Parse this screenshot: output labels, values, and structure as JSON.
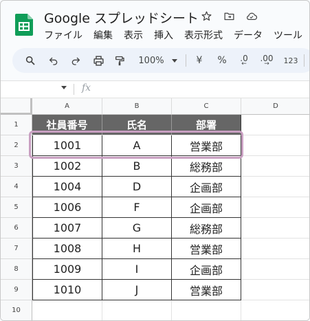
{
  "app": {
    "title": "Google スプレッドシート",
    "brand_color": "#0f9d58"
  },
  "title_icons": [
    {
      "name": "star-icon",
      "glyph": "☆"
    },
    {
      "name": "move-to-folder-icon",
      "glyph": "folder"
    },
    {
      "name": "cloud-status-icon",
      "glyph": "cloud"
    }
  ],
  "menu": [
    "ファイル",
    "編集",
    "表示",
    "挿入",
    "表示形式",
    "データ",
    "ツール"
  ],
  "toolbar": {
    "zoom": "100%",
    "currency_symbol": "¥",
    "percent_symbol": "%",
    "decrease_decimal": ".0",
    "increase_decimal": ".00",
    "number_format": "123"
  },
  "formula_bar": {
    "fx_label": "fx",
    "cell_ref": "",
    "content": ""
  },
  "columns": [
    "A",
    "B",
    "C",
    "D"
  ],
  "rows": [
    "1",
    "2",
    "3",
    "4",
    "5",
    "6",
    "7",
    "8",
    "9",
    "10"
  ],
  "table": {
    "headers": [
      "社員番号",
      "氏名",
      "部署"
    ],
    "rows": [
      [
        "1001",
        "A",
        "営業部"
      ],
      [
        "1002",
        "B",
        "総務部"
      ],
      [
        "1004",
        "D",
        "企画部"
      ],
      [
        "1006",
        "F",
        "企画部"
      ],
      [
        "1007",
        "G",
        "総務部"
      ],
      [
        "1008",
        "H",
        "営業部"
      ],
      [
        "1009",
        "I",
        "企画部"
      ],
      [
        "1010",
        "J",
        "営業部"
      ]
    ],
    "header_bg": "#666666",
    "highlight_color": "#c9a0c2"
  }
}
